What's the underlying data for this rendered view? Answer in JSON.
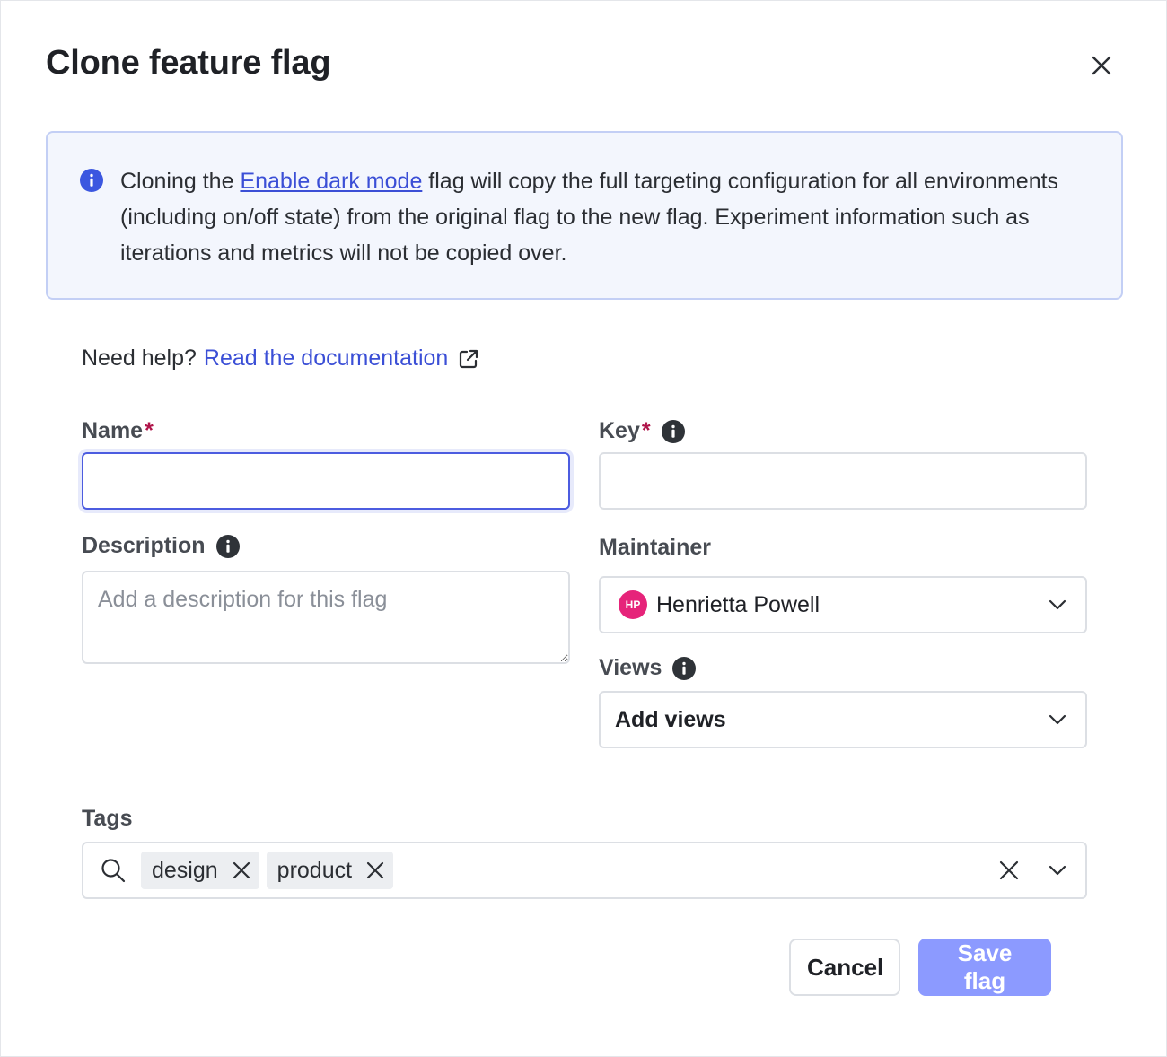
{
  "dialog": {
    "title": "Clone feature flag",
    "close_icon": "close-icon"
  },
  "info": {
    "icon": "info-icon",
    "text_before": "Cloning the ",
    "link": "Enable dark mode",
    "text_after": " flag will copy the full targeting configuration for all environments (including on/off state) from the original flag to the new flag. Experiment information such as iterations and metrics will not be copied over."
  },
  "help": {
    "prefix": "Need help?",
    "link": "Read the documentation",
    "icon": "external-link-icon"
  },
  "form": {
    "name": {
      "label": "Name",
      "required": "*",
      "value": ""
    },
    "key": {
      "label": "Key",
      "required": "*",
      "value": ""
    },
    "description": {
      "label": "Description",
      "placeholder": "Add a description for this flag"
    },
    "maintainer": {
      "label": "Maintainer",
      "initials": "HP",
      "value": "Henrietta Powell"
    },
    "views": {
      "label": "Views",
      "value": "Add views"
    },
    "tags": {
      "label": "Tags",
      "items": [
        "design",
        "product"
      ]
    }
  },
  "actions": {
    "cancel": "Cancel",
    "save": "Save flag"
  },
  "colors": {
    "link": "#3b4fd6",
    "required": "#b0154a",
    "primary_disabled": "#8c9aff",
    "avatar": "#e6247a",
    "info_bg": "#f3f6fd"
  }
}
